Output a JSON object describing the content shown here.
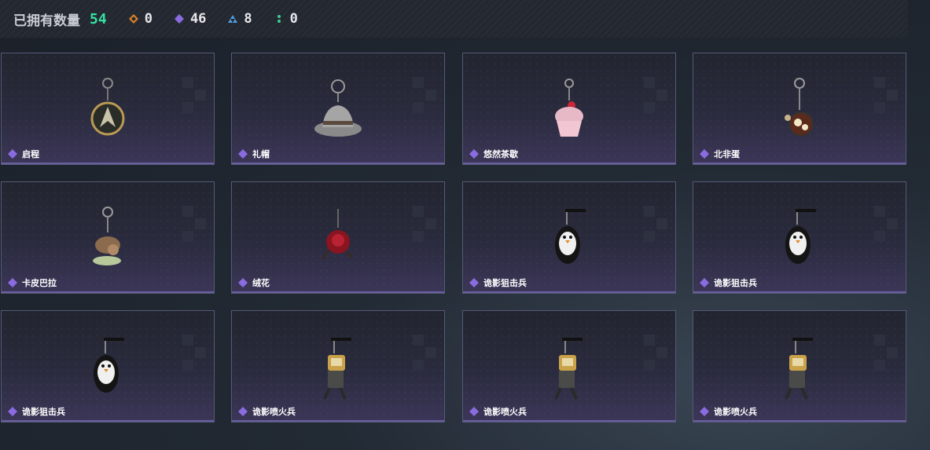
{
  "header": {
    "owned_label": "已拥有数量",
    "owned_count": "54",
    "stats": [
      {
        "icon": "orange-diamond-icon",
        "color": "#d9822b",
        "value": "0"
      },
      {
        "icon": "purple-diamond-icon",
        "color": "#8a6ce0",
        "value": "46"
      },
      {
        "icon": "blue-triangle-icon",
        "color": "#4f9ddc",
        "value": "8"
      },
      {
        "icon": "green-dots-icon",
        "color": "#3bd08f",
        "value": "0"
      }
    ]
  },
  "items": [
    {
      "name": "启程",
      "icon": "compass-charm-icon"
    },
    {
      "name": "礼帽",
      "icon": "fedora-hat-charm-icon"
    },
    {
      "name": "悠然茶歇",
      "icon": "cupcake-charm-icon"
    },
    {
      "name": "北非蛋",
      "icon": "shakshuka-pan-charm-icon"
    },
    {
      "name": "卡皮巴拉",
      "icon": "capybara-charm-icon"
    },
    {
      "name": "绒花",
      "icon": "red-rose-charm-icon"
    },
    {
      "name": "诡影狙击兵",
      "icon": "penguin-sniper-charm-icon"
    },
    {
      "name": "诡影狙击兵",
      "icon": "penguin-sniper-charm-icon"
    },
    {
      "name": "诡影狙击兵",
      "icon": "penguin-sniper-charm-icon"
    },
    {
      "name": "诡影喷火兵",
      "icon": "flamethrower-soldier-charm-icon"
    },
    {
      "name": "诡影喷火兵",
      "icon": "flamethrower-soldier-charm-icon"
    },
    {
      "name": "诡影喷火兵",
      "icon": "flamethrower-soldier-charm-icon"
    }
  ],
  "colors": {
    "rarity": "#8a6ce0",
    "accent_green": "#35e0a0"
  }
}
